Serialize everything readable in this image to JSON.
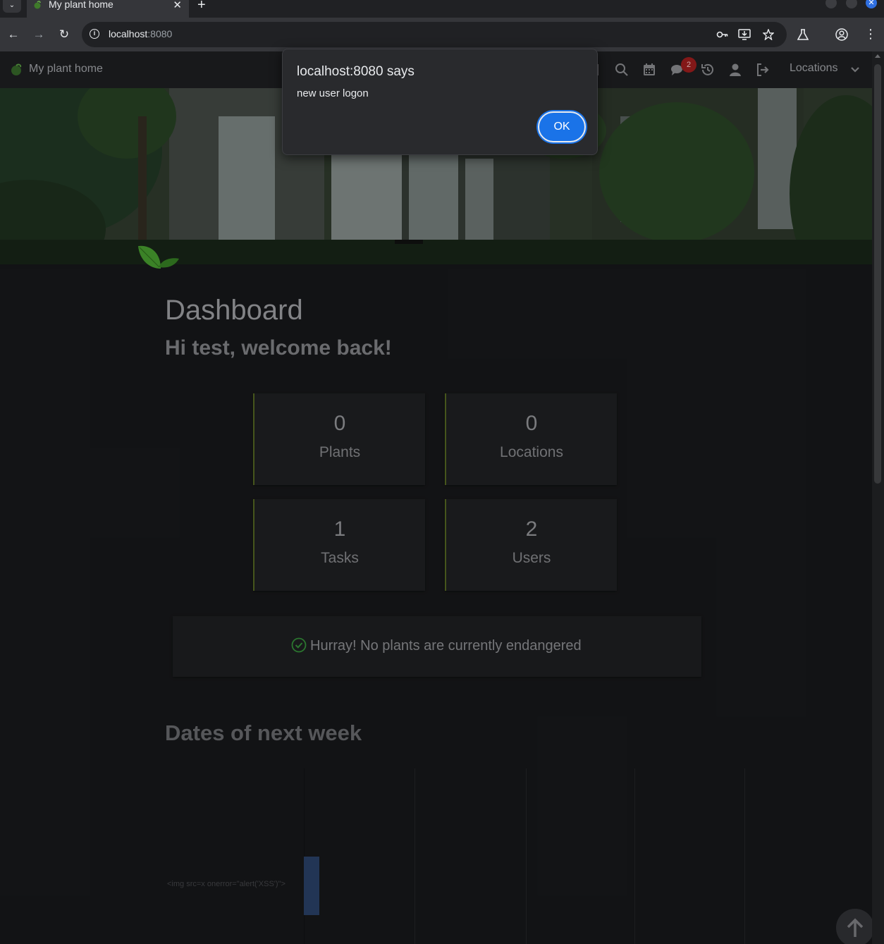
{
  "browser": {
    "tab_title": "My plant home",
    "tab_close": "✕",
    "new_tab": "+",
    "url_host": "localhost",
    "url_port": ":8080"
  },
  "app": {
    "brand": "My plant home",
    "notification_count": "2",
    "locations_label": "Locations"
  },
  "dialog": {
    "title": "localhost:8080 says",
    "message": "new user logon",
    "ok_label": "OK"
  },
  "dashboard": {
    "title": "Dashboard",
    "welcome": "Hi test, welcome back!",
    "stats": [
      {
        "value": "0",
        "label": "Plants"
      },
      {
        "value": "0",
        "label": "Locations"
      },
      {
        "value": "1",
        "label": "Tasks"
      },
      {
        "value": "2",
        "label": "Users"
      }
    ],
    "endangered_message": "Hurray! No plants are currently endangered",
    "dates_title": "Dates of next week",
    "timeline_item_label": "<img src=x onerror=\"alert('XSS')\">"
  },
  "colors": {
    "accent_blue": "#1a73e8",
    "card_border": "#4a5a1e",
    "badge_red": "#8b1a1a",
    "check_green": "#2e7d32"
  }
}
